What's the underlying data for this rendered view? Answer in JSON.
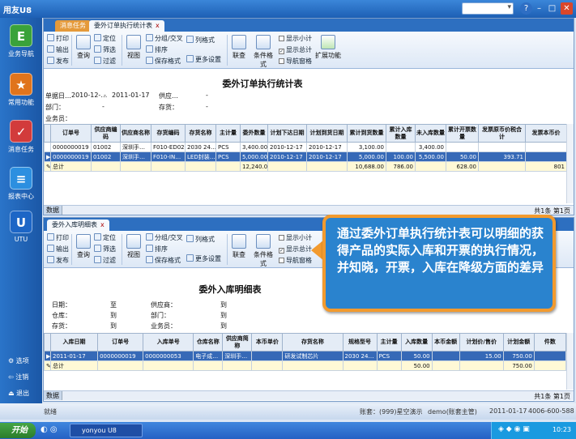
{
  "app": {
    "title": "用友U8"
  },
  "window": {
    "help": "?",
    "minimize": "–",
    "maximize": "□",
    "close": "✕",
    "search_arrow": "▾"
  },
  "nav": {
    "items": [
      {
        "label": "业务导航",
        "glyph": "E",
        "color": "#3aa23a"
      },
      {
        "label": "常用功能",
        "glyph": "★",
        "color": "#e0741c"
      },
      {
        "label": "消息任务",
        "glyph": "✓",
        "color": "#d23b3b"
      },
      {
        "label": "报表中心",
        "glyph": "≡",
        "color": "#2c8fe0"
      },
      {
        "label": "UTU",
        "glyph": "U",
        "color": "#1d66c6"
      }
    ],
    "bottom": [
      {
        "label": "选项",
        "icon": "⚙"
      },
      {
        "label": "注销",
        "icon": "⇦"
      },
      {
        "label": "退出",
        "icon": "⏏"
      }
    ]
  },
  "tabs": {
    "first": "消息任务",
    "second": "委外订单执行统计表",
    "third": "委外入库明细表",
    "close": "x"
  },
  "ribbon": {
    "print": "打印",
    "output": "输出",
    "publish": "发布",
    "query": "查询",
    "locate": "定位",
    "filter": "筛选",
    "filter2": "过滤",
    "view": "视图",
    "group": "分组/交叉",
    "sort": "排序",
    "save_format": "保存格式",
    "column_format": "列格式",
    "more_settings": "更多设置",
    "linked": "联查",
    "conditional_format": "条件格式",
    "show_subtotal": "显示小计",
    "show_total": "显示总计",
    "show_nav": "导航窗格",
    "extension": "扩展功能",
    "check": "✓"
  },
  "report1": {
    "title": "委外订单执行统计表",
    "filters": {
      "order_date_label": "单据日…",
      "date_from": "2010-12-…",
      "date_to_sep": "-",
      "date_to": "2011-01-17",
      "supplier_label": "供应…",
      "supplier_val": "-",
      "dept_label": "部门：",
      "dept_val": "-",
      "stock_label": "存货：",
      "stock_val": "-",
      "staff_label": "业务员："
    },
    "columns": [
      "订单号",
      "供应商编码",
      "供应商名称",
      "存货编码",
      "存货名称",
      "主计量",
      "委外数量",
      "计划下达日期",
      "计划到货日期",
      "累计到货数量",
      "累计入库数量",
      "未入库数量",
      "累计开票数量",
      "发票原币价税合计",
      "发票本币价"
    ],
    "rows": [
      [
        "0000000019",
        "01002",
        "深圳手…",
        "F010-ED02",
        "2030 24…",
        "PCS",
        "3,400.00",
        "2010-12-17",
        "2010-12-17",
        "3,100.00",
        "",
        "3,400.00",
        "",
        "",
        ""
      ],
      [
        "0000000019",
        "01002",
        "深圳手…",
        "F010-IN…",
        "LED封装…",
        "PCS",
        "5,000.00",
        "2010-12-17",
        "2010-12-17",
        "5,000.00",
        "100.00",
        "5,500.00",
        "50.00",
        "393.71",
        ""
      ]
    ],
    "total": [
      "总计",
      "",
      "",
      "",
      "",
      "",
      "12,240.00",
      "",
      "",
      "10,688.00",
      "786.00",
      "",
      "628.00",
      "",
      "801"
    ],
    "pager_left": "数据",
    "pager_right": "共1条 第1页"
  },
  "report2": {
    "title": "委外入库明细表",
    "filters": {
      "date_label": "日期：",
      "date_val": "至",
      "wh_label": "仓库：",
      "wh_val": "到",
      "stock_label": "存货：",
      "stock_val": "到",
      "supplier_label": "供应商：",
      "supplier_val": "到",
      "dept_label": "部门：",
      "dept_val": "到",
      "staff_label": "业务员：",
      "staff_val": "到"
    },
    "columns": [
      "入库日期",
      "订单号",
      "入库单号",
      "仓库名称",
      "供应商简称",
      "本币单价",
      "存货名称",
      "规格型号",
      "主计量",
      "入库数量",
      "本币金额",
      "计划价/售价",
      "计划金额",
      "件数"
    ],
    "rows": [
      [
        "2011-01-17",
        "0000000019",
        "0000000053",
        "电子成…",
        "深圳手…",
        "",
        "研发试制芯片",
        "2030 24…",
        "PCS",
        "50.00",
        "",
        "15.00",
        "750.00",
        ""
      ]
    ],
    "total": [
      "总计",
      "",
      "",
      "",
      "",
      "",
      "",
      "",
      "",
      "50.00",
      "",
      "",
      "750.00",
      ""
    ],
    "pager_left": "数据",
    "pager_right": "共1条 第1页"
  },
  "callout": {
    "text": "通过委外订单执行统计表可以明细的获得产品的实际入库和开票的执行情况，并知晓，开票，入库在降级方面的差异"
  },
  "status": {
    "ready": "就绪",
    "account": "账套：(999)星空演示",
    "user": "demo(账套主管)",
    "date": "2011-01-17",
    "phone": "4006-600-588"
  },
  "taskbar": {
    "start": "开始",
    "task": "yonyou U8",
    "time": "10:23"
  },
  "colors": {
    "accent": "#2d6fc0",
    "callout_border": "#f29a2e",
    "selection": "#3669b7"
  }
}
